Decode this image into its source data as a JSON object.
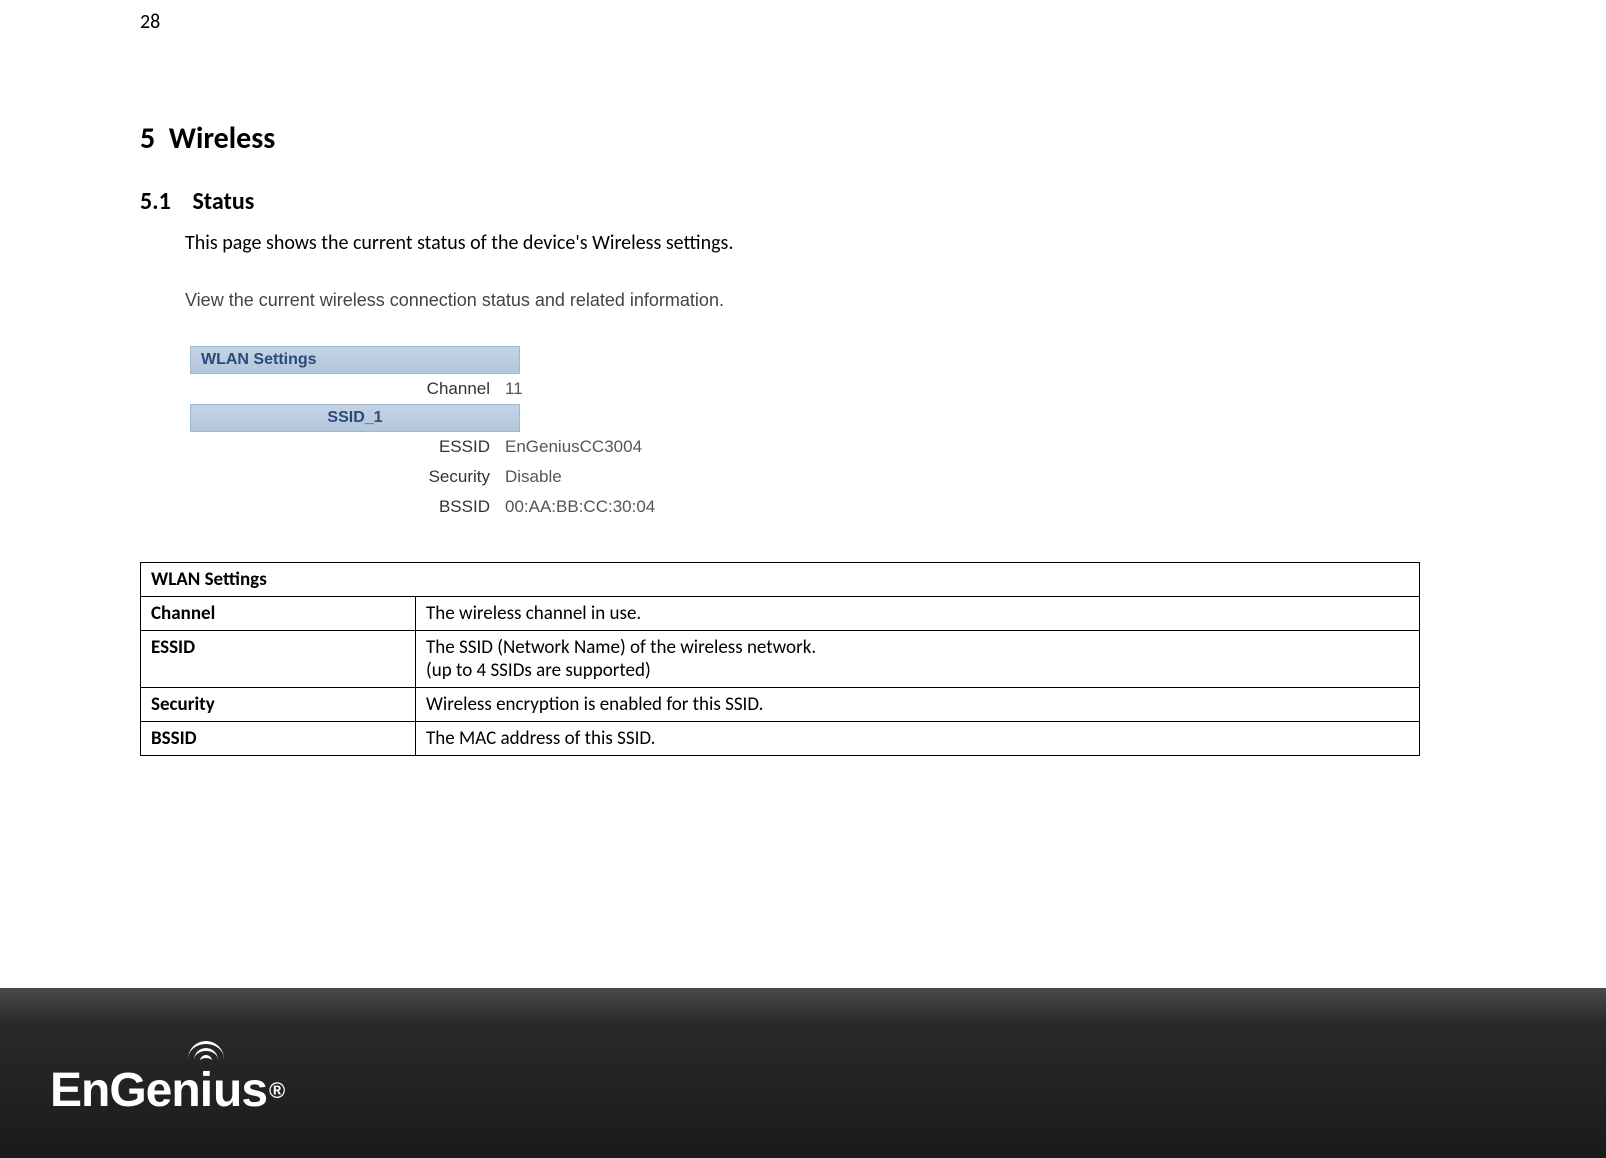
{
  "page_number": "28",
  "chapter": {
    "number": "5",
    "title": "Wireless"
  },
  "section": {
    "number": "5.1",
    "title": "Status"
  },
  "intro": "This page shows the current status of the device's Wireless settings.",
  "panel": {
    "description": "View the current wireless connection status and related information.",
    "header": "WLAN Settings",
    "channel_label": "Channel",
    "channel_value": "11",
    "ssid_header": "SSID_1",
    "essid_label": "ESSID",
    "essid_value": "EnGeniusCC3004",
    "security_label": "Security",
    "security_value": "Disable",
    "bssid_label": "BSSID",
    "bssid_value": "00:AA:BB:CC:30:04"
  },
  "description_table": {
    "header": "WLAN Settings",
    "rows": [
      {
        "label": "Channel",
        "value": "The wireless channel in use."
      },
      {
        "label": "ESSID",
        "value": "The SSID (Network Name) of the wireless network.\n(up to 4 SSIDs are supported)"
      },
      {
        "label": "Security",
        "value": "Wireless encryption is enabled for this SSID."
      },
      {
        "label": "BSSID",
        "value": "The MAC address of this SSID."
      }
    ]
  },
  "logo": {
    "text": "EnGenius",
    "registered": "®"
  }
}
